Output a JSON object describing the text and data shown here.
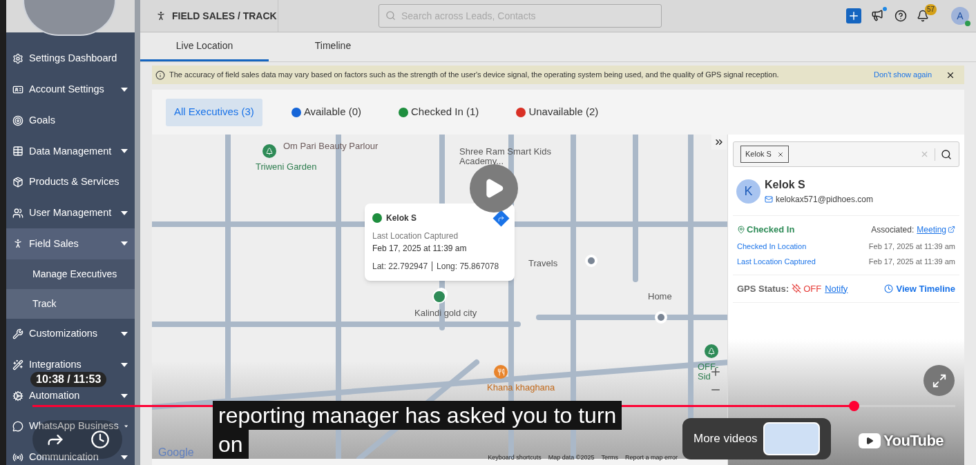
{
  "sidebar": {
    "items": [
      {
        "label": "Settings Dashboard",
        "kind": "link",
        "selected": false
      },
      {
        "label": "Account Settings",
        "kind": "dropdown",
        "selected": false
      },
      {
        "label": "Goals",
        "kind": "link",
        "selected": false
      },
      {
        "label": "Data Management",
        "kind": "dropdown",
        "selected": false
      },
      {
        "label": "Products & Services",
        "kind": "link",
        "selected": false
      },
      {
        "label": "User Management",
        "kind": "dropdown",
        "selected": false
      },
      {
        "label": "Field Sales",
        "kind": "dropdown",
        "selected": true,
        "children": [
          {
            "label": "Manage Executives",
            "selected": false
          },
          {
            "label": "Track",
            "selected": true
          }
        ]
      },
      {
        "label": "Customizations",
        "kind": "dropdown",
        "selected": false
      },
      {
        "label": "Integrations",
        "kind": "dropdown",
        "selected": false
      },
      {
        "label": "Automation",
        "kind": "dropdown",
        "selected": false
      },
      {
        "label": "WhatsApp Business",
        "kind": "dropdown",
        "selected": false
      },
      {
        "label": "Communication",
        "kind": "dropdown",
        "selected": false
      }
    ]
  },
  "header": {
    "title": "FIELD SALES / TRACK",
    "search": {
      "placeholder": "Search across Leads, Contacts"
    },
    "notification_count": "57",
    "avatar": "A"
  },
  "tabs": [
    {
      "label": "Live Location",
      "selected": true
    },
    {
      "label": "Timeline",
      "selected": false
    }
  ],
  "notice": {
    "text": "The accuracy of field sales data may vary based on factors such as the strength of the user's device signal, the operating system being used, and the quality of GPS signal reception.",
    "action": "Don't show again"
  },
  "filters": [
    {
      "label": "All Executives (3)",
      "selected": true
    },
    {
      "label": "Available (0)",
      "selected": false,
      "color": "#1565d8"
    },
    {
      "label": "Checked In (1)",
      "selected": false,
      "color": "#1e8e3e"
    },
    {
      "label": "Unavailable (2)",
      "selected": false,
      "color": "#d93025"
    }
  ],
  "map": {
    "places": [
      {
        "name": "Om Pari Beauty Parlour",
        "kind": "plain"
      },
      {
        "name": "Shree Ram Smart Kids Academy...",
        "kind": "plain"
      },
      {
        "name": "Triweni Garden",
        "kind": "park"
      },
      {
        "name": "Travels",
        "kind": "pin"
      },
      {
        "name": "Kalindi gold city",
        "kind": "pin"
      },
      {
        "name": "Home",
        "kind": "pin"
      },
      {
        "name": "OFF-Sid",
        "kind": "park"
      },
      {
        "name": "Khana khaghana",
        "kind": "food"
      }
    ],
    "popup": {
      "name": "Kelok S",
      "caption": "Last Location Captured",
      "time": "Feb 17, 2025 at 11:39 am",
      "lat": "Lat: 22.792947",
      "long": "Long: 75.867078"
    },
    "footer": [
      "Keyboard shortcuts",
      "Map data ©2025",
      "Terms",
      "Report a map error"
    ],
    "logo": "Google"
  },
  "panel": {
    "chip": "Kelok S",
    "name": "Kelok S",
    "initial": "K",
    "email": "kelokax571@pidhoes.com",
    "status": "Checked In",
    "associated_label": "Associated:",
    "associated_link": "Meeting",
    "rows": [
      {
        "label": "Checked In Location",
        "value": "Feb 17, 2025 at 11:39 am"
      },
      {
        "label": "Last Location Captured",
        "value": "Feb 17, 2025 at 11:39 am"
      }
    ],
    "gps_label": "GPS Status:",
    "gps_value": "OFF",
    "notify": "Notify",
    "timeline": "View Timeline"
  },
  "player": {
    "time": "10:38 / 11:53",
    "level": 0.89,
    "caption_lines": [
      "reporting manager has asked you to turn",
      "on"
    ],
    "more_videos": "More videos",
    "brand": "YouTube"
  }
}
